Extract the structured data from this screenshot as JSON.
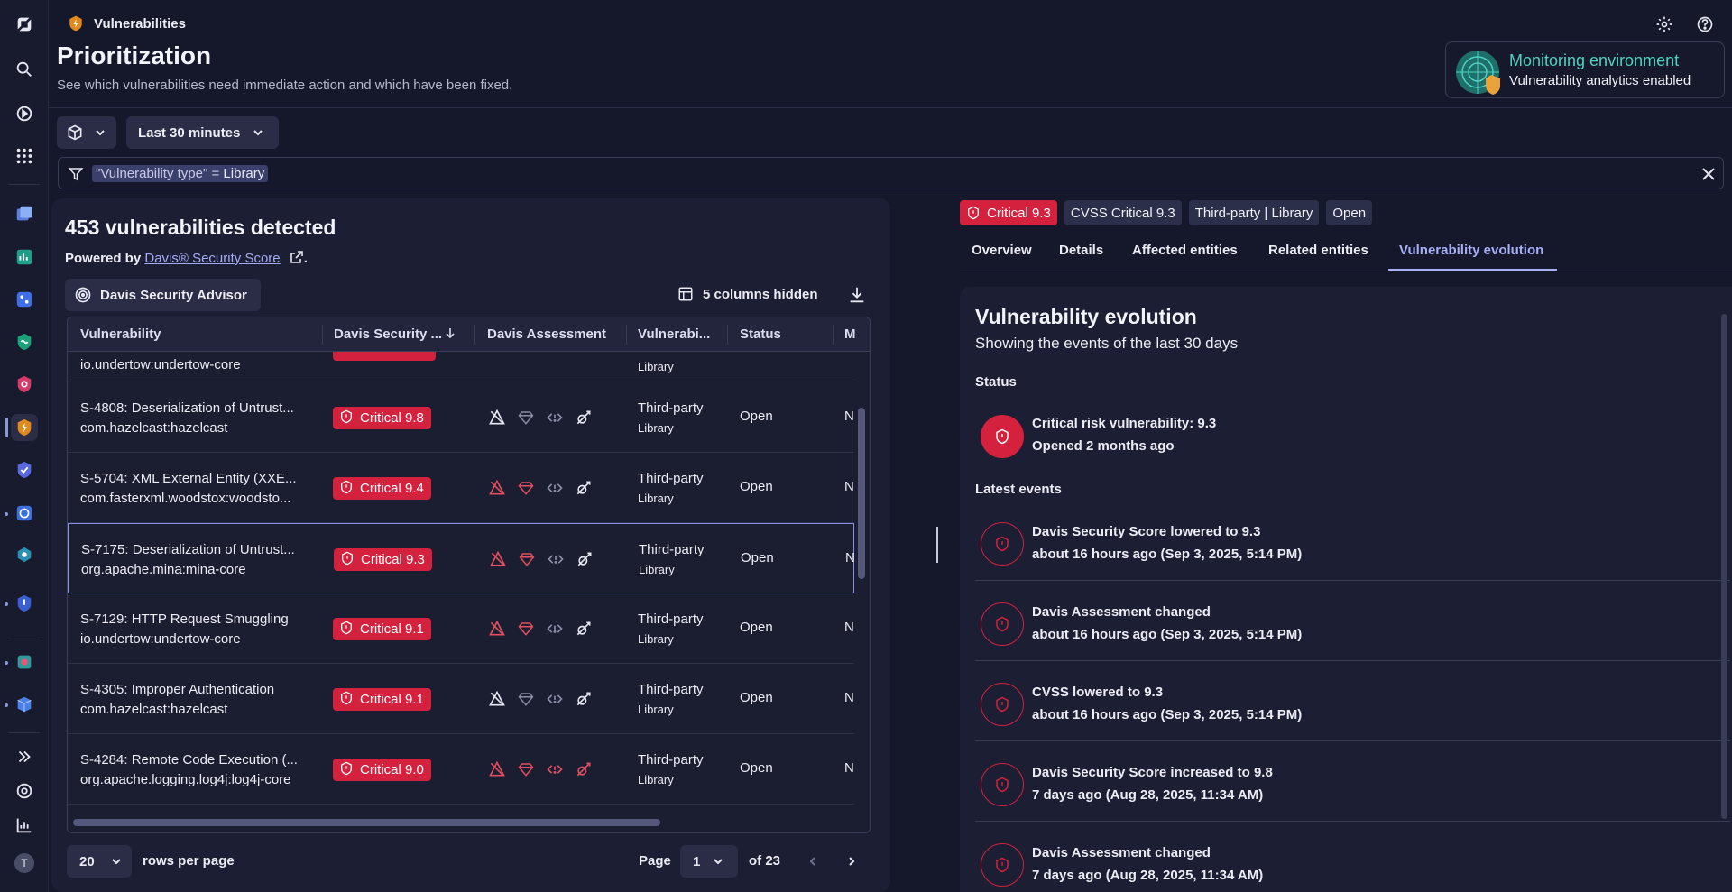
{
  "app": {
    "title": "Vulnerabilities"
  },
  "page": {
    "title": "Prioritization",
    "subtitle": "See which vulnerabilities need immediate action and which have been fixed."
  },
  "monitoring": {
    "title": "Monitoring environment",
    "subtitle": "Vulnerability analytics enabled"
  },
  "toolbar": {
    "timeframe": "Last 30 minutes"
  },
  "filter": {
    "key": "\"Vulnerability type\" = ",
    "value": "Library"
  },
  "list": {
    "heading": "453 vulnerabilities detected",
    "powered_prefix": "Powered by ",
    "powered_link": "Davis® Security Score",
    "powered_suffix": ".",
    "advisor_label": "Davis Security Advisor",
    "columns_hidden": "5 columns hidden",
    "columns": [
      "Vulnerability",
      "Davis Security ...",
      "Davis Assessment",
      "Vulnerabi...",
      "Status",
      "M"
    ],
    "partial_row": {
      "line2": "io.undertow:undertow-core"
    },
    "rows": [
      {
        "title": "S-4808: Deserialization of Untrust...",
        "component": "com.hazelcast:hazelcast",
        "score": "Critical 9.8",
        "type": "Third-party",
        "type_sub": "Library",
        "status": "Open",
        "m": "N"
      },
      {
        "title": "S-5704: XML External Entity (XXE...",
        "component": "com.fasterxml.woodstox:woodsto...",
        "score": "Critical 9.4",
        "type": "Third-party",
        "type_sub": "Library",
        "status": "Open",
        "m": "N"
      },
      {
        "title": "S-7175: Deserialization of Untrust...",
        "component": "org.apache.mina:mina-core",
        "score": "Critical 9.3",
        "type": "Third-party",
        "type_sub": "Library",
        "status": "Open",
        "m": "N"
      },
      {
        "title": "S-7129: HTTP Request Smuggling",
        "component": "io.undertow:undertow-core",
        "score": "Critical 9.1",
        "type": "Third-party",
        "type_sub": "Library",
        "status": "Open",
        "m": "N"
      },
      {
        "title": "S-4305: Improper Authentication",
        "component": "com.hazelcast:hazelcast",
        "score": "Critical 9.1",
        "type": "Third-party",
        "type_sub": "Library",
        "status": "Open",
        "m": "N"
      },
      {
        "title": "S-4284: Remote Code Execution (...",
        "component": "org.apache.logging.log4j:log4j-core",
        "score": "Critical 9.0",
        "type": "Third-party",
        "type_sub": "Library",
        "status": "Open",
        "m": "N"
      }
    ],
    "pager": {
      "rows": "20",
      "rows_label": "rows per page",
      "page_label": "Page",
      "page": "1",
      "of": "of 23"
    }
  },
  "detail": {
    "badges": {
      "risk": "Critical 9.3",
      "cvss": "CVSS Critical 9.3",
      "type": "Third-party | Library",
      "status": "Open"
    },
    "tabs": [
      "Overview",
      "Details",
      "Affected entities",
      "Related entities",
      "Vulnerability evolution"
    ],
    "evolution": {
      "title": "Vulnerability evolution",
      "subtitle": "Showing the events of the last 30 days",
      "status_heading": "Status",
      "status_line1": "Critical risk vulnerability: 9.3",
      "status_line2": "Opened 2 months ago",
      "events_heading": "Latest events",
      "events": [
        {
          "title": "Davis Security Score lowered to 9.3",
          "time": "about 16 hours ago (Sep 3, 2025, 5:14 PM)"
        },
        {
          "title": "Davis Assessment changed",
          "time": "about 16 hours ago (Sep 3, 2025, 5:14 PM)"
        },
        {
          "title": "CVSS lowered to 9.3",
          "time": "about 16 hours ago (Sep 3, 2025, 5:14 PM)"
        },
        {
          "title": "Davis Security Score increased to 9.8",
          "time": "7 days ago (Aug 28, 2025, 11:34 AM)"
        },
        {
          "title": "Davis Assessment changed",
          "time": "7 days ago (Aug 28, 2025, 11:34 AM)"
        }
      ]
    }
  },
  "rail": {
    "avatar_initial": "T"
  },
  "colors": {
    "critical": "#d4213d",
    "accent": "#a8aef7",
    "teal": "#4fd1c1"
  }
}
